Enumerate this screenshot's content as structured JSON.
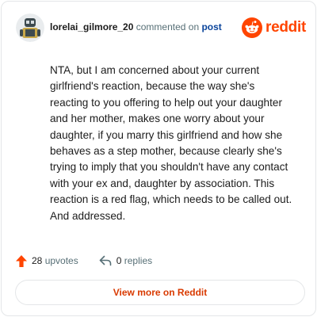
{
  "header": {
    "username": "lorelai_gilmore_20",
    "action": "commented on",
    "target": "post",
    "brand": "reddit",
    "avatar_icon": "robot-avatar-icon",
    "logo_icon": "reddit-snoo-icon"
  },
  "comment": {
    "text": "NTA, but I am concerned about your current girlfriend's reaction, because the way she's reacting to you offering to help out your daughter and her mother, makes one worry about your daughter, if you marry this girlfriend and how she behaves as a step mother, because clearly she's trying to imply that you shouldn't have any contact with your ex and, daughter by association. This reaction is a red flag, which needs to be called out. And addressed."
  },
  "stats": {
    "upvotes_count": "28",
    "upvotes_label": "upvotes",
    "replies_count": "0",
    "replies_label": "replies"
  },
  "actions": {
    "view_more_label": "View more on Reddit"
  },
  "colors": {
    "brand": "#ff4500",
    "link": "#0a449b",
    "button_text": "#d93a00",
    "muted": "#576f76"
  }
}
